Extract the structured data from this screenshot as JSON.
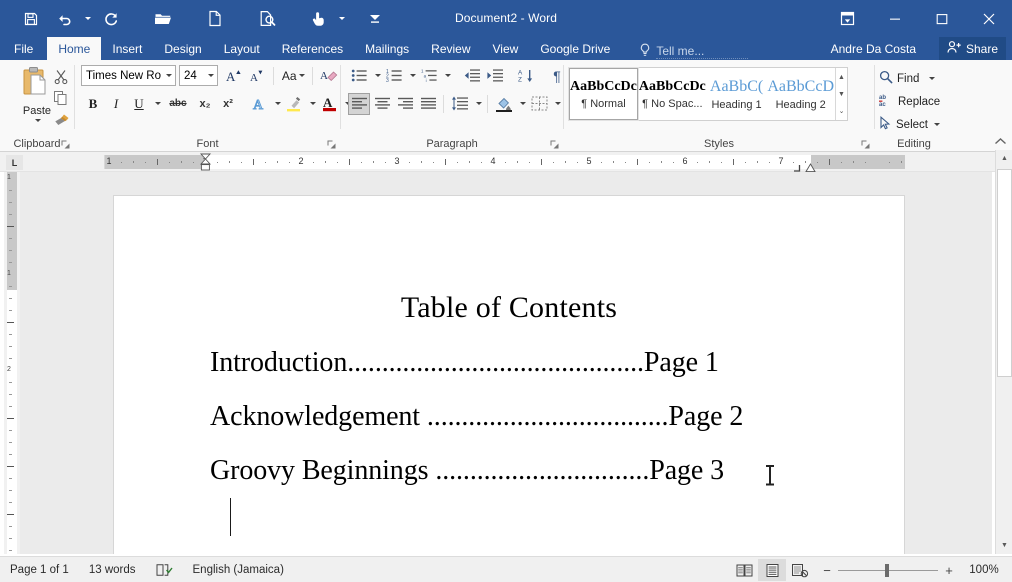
{
  "window": {
    "title": "Document2 - Word",
    "quick_access": [
      {
        "name": "save",
        "icon": "save-icon"
      },
      {
        "name": "undo",
        "icon": "undo-icon",
        "has_caret": true
      },
      {
        "name": "redo",
        "icon": "redo-icon"
      },
      {
        "name": "open",
        "icon": "open-folder-icon"
      },
      {
        "name": "new",
        "icon": "new-document-icon"
      },
      {
        "name": "print-preview",
        "icon": "print-preview-icon"
      },
      {
        "name": "touch-mode",
        "icon": "touch-mouse-mode-icon",
        "has_caret": true
      },
      {
        "name": "customize-quick-access-toolbar",
        "icon": "chevron-down-bar-icon"
      }
    ],
    "controls": {
      "ribbon_display_options": "⊡",
      "minimize": "—",
      "maximize": "☐",
      "close": "✕"
    }
  },
  "tabs": [
    {
      "label": "File",
      "active": false
    },
    {
      "label": "Home",
      "active": true
    },
    {
      "label": "Insert",
      "active": false
    },
    {
      "label": "Design",
      "active": false
    },
    {
      "label": "Layout",
      "active": false
    },
    {
      "label": "References",
      "active": false
    },
    {
      "label": "Mailings",
      "active": false
    },
    {
      "label": "Review",
      "active": false
    },
    {
      "label": "View",
      "active": false
    },
    {
      "label": "Google Drive",
      "active": false
    }
  ],
  "tell_me": {
    "placeholder": "Tell me...",
    "icon": "lightbulb-icon"
  },
  "account": {
    "name": "Andre Da Costa",
    "share_label": "Share",
    "share_icon": "person-share-icon"
  },
  "ribbon": {
    "groups": [
      {
        "name": "clipboard",
        "label": "Clipboard",
        "paste_label": "Paste",
        "items": [
          "Cut",
          "Copy",
          "Format Painter"
        ]
      },
      {
        "name": "font",
        "label": "Font",
        "font_name": "Times New Ro",
        "font_size": "24",
        "buttons": [
          "Grow Font",
          "Shrink Font",
          "Change Case",
          "Clear Formatting",
          "Bold",
          "Italic",
          "Underline",
          "Strikethrough",
          "Subscript",
          "Superscript",
          "Text Effects",
          "Text Highlight Color",
          "Font Color"
        ],
        "bold": "B",
        "italic": "I",
        "underline": "U",
        "strikethrough": "abc",
        "subscript": "x₂",
        "superscript": "x²",
        "grow_font": "A",
        "shrink_font": "A",
        "change_case": "Aa"
      },
      {
        "name": "paragraph",
        "label": "Paragraph",
        "buttons": [
          "Bullets",
          "Numbering",
          "Multilevel List",
          "Decrease Indent",
          "Increase Indent",
          "Sort",
          "Show/Hide ¶",
          "Align Left",
          "Center",
          "Align Right",
          "Justify",
          "Line and Paragraph Spacing",
          "Shading",
          "Borders"
        ],
        "align_left_selected": true
      },
      {
        "name": "styles",
        "label": "Styles",
        "gallery": [
          {
            "preview": "AaBbCcDc",
            "name": "¶ Normal",
            "active": true,
            "heading": false
          },
          {
            "preview": "AaBbCcDc",
            "name": "¶ No Spac...",
            "active": false,
            "heading": false
          },
          {
            "preview": "AaBbC(",
            "name": "Heading 1",
            "active": false,
            "heading": true
          },
          {
            "preview": "AaBbCcD",
            "name": "Heading 2",
            "active": false,
            "heading": true
          }
        ]
      },
      {
        "name": "editing",
        "label": "Editing",
        "items": [
          {
            "label": "Find",
            "icon": "magnifier-icon",
            "has_caret": true
          },
          {
            "label": "Replace",
            "icon": "ab-ac-replace-icon",
            "has_caret": false
          },
          {
            "label": "Select",
            "icon": "cursor-arrow-icon",
            "has_caret": true
          }
        ]
      }
    ],
    "collapse_icon": "chevron-up-icon"
  },
  "ruler": {
    "horizontal_numbers": [
      "1",
      "1",
      "2",
      "3",
      "4",
      "5",
      "6",
      "7"
    ],
    "vertical_numbers": [
      "1",
      "1",
      "2"
    ],
    "tab_stop_label": "L"
  },
  "document": {
    "title": "Table of Contents",
    "entries": [
      {
        "label": "Introduction",
        "leader": "...........................................",
        "page": "Page 1"
      },
      {
        "label": "Acknowledgement ",
        "leader": "...................................",
        "page": "Page 2"
      },
      {
        "label": "Groovy Beginnings ",
        "leader": "...............................",
        "page": "Page 3"
      }
    ]
  },
  "status_bar": {
    "page_info": "Page 1 of 1",
    "word_count": "13 words",
    "proofing_icon": "proofing-errors-icon",
    "language": "English (Jamaica)",
    "view_buttons": [
      {
        "name": "read-mode",
        "icon": "read-mode-icon",
        "active": false
      },
      {
        "name": "print-layout",
        "icon": "print-layout-icon",
        "active": true
      },
      {
        "name": "web-layout",
        "icon": "web-layout-icon",
        "active": false
      }
    ],
    "zoom_out": "−",
    "zoom_in": "+",
    "zoom_level": "100%"
  },
  "colors": {
    "brand_blue": "#2b579a",
    "tab_active_bg": "#f9f9f9",
    "ribbon_bg": "#f9f9f9",
    "doc_bg": "#ebebeb",
    "heading_style_blue": "#5b9bd5"
  }
}
